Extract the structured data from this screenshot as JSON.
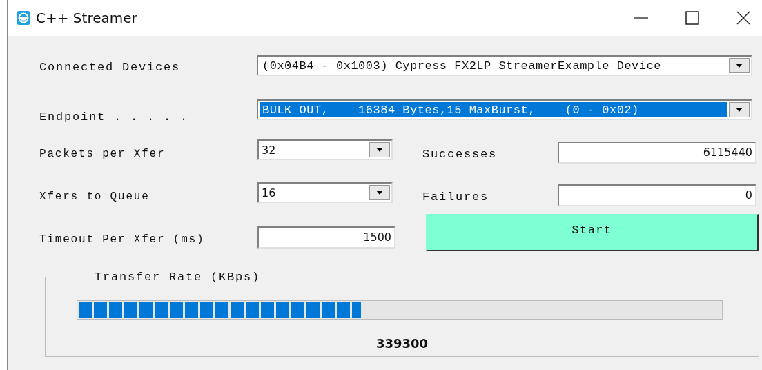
{
  "window": {
    "title": "C++ Streamer"
  },
  "fields": [
    {
      "kind": "combo",
      "label": "Connected Devices",
      "value": "(0x04B4 - 0x1003) Cypress FX2LP StreamerExample Device",
      "selected": false
    },
    {
      "kind": "combo",
      "label": "Endpoint . . . . .",
      "value": "BULK OUT,    16384 Bytes,15 MaxBurst,    (0 - 0x02)",
      "selected": true
    }
  ],
  "settings": [
    {
      "kind": "combo",
      "label": "Packets per Xfer",
      "value": "32"
    },
    {
      "kind": "combo",
      "label": "Xfers to Queue",
      "value": "16"
    },
    {
      "kind": "input",
      "label": "Timeout Per Xfer (ms)",
      "value": "1500"
    }
  ],
  "counters": [
    {
      "label": "Successes",
      "value": "6115440"
    },
    {
      "label": "Failures",
      "value": "0"
    }
  ],
  "start_button": "Start",
  "transfer_rate": {
    "title": "Transfer Rate (KBps)",
    "level": 0.44,
    "value": "339300"
  }
}
